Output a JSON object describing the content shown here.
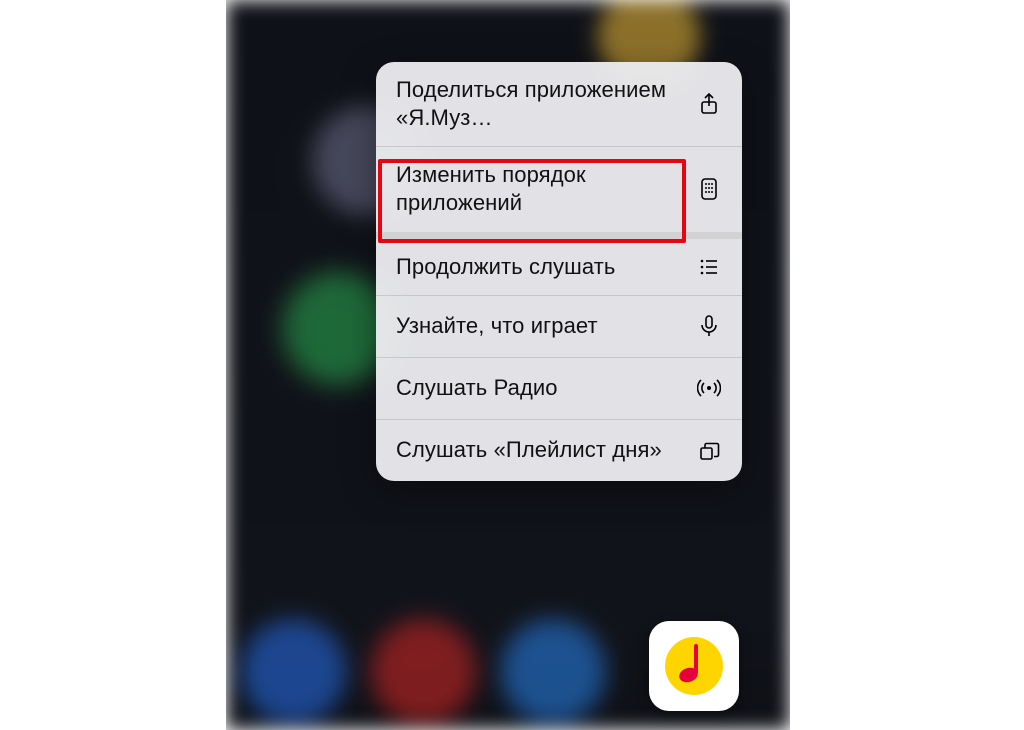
{
  "menu": {
    "items": [
      {
        "label": "Поделиться приложением «Я.Муз…"
      },
      {
        "label": "Изменить порядок приложений"
      },
      {
        "label": "Продолжить слушать"
      },
      {
        "label": "Узнайте, что играет"
      },
      {
        "label": "Слушать Радио"
      },
      {
        "label": "Слушать «Плейлист дня»"
      }
    ]
  },
  "app_icon_name": "yandex-music-app-icon",
  "colors": {
    "highlight": "#e30613",
    "icon_yellow": "#ffd500",
    "icon_red": "#e6003c"
  }
}
